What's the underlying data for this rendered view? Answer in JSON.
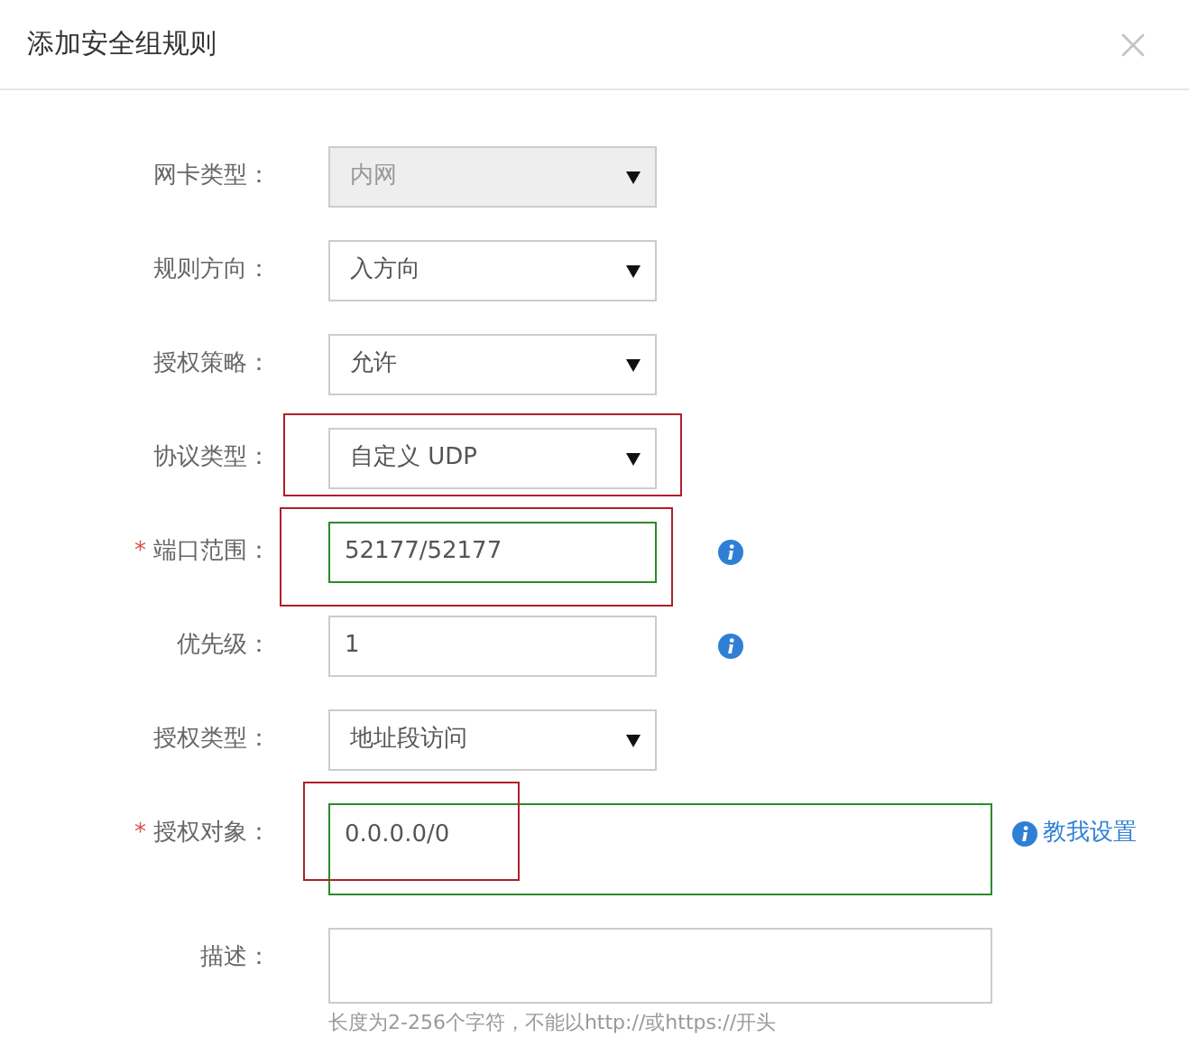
{
  "dialog": {
    "title": "添加安全组规则"
  },
  "fields": [
    {
      "label": "网卡类型：",
      "required": false,
      "kind": "select",
      "value": "内网",
      "disabled": true,
      "valid": false,
      "info": false,
      "annotated": false
    },
    {
      "label": "规则方向：",
      "required": false,
      "kind": "select",
      "value": "入方向",
      "disabled": false,
      "valid": false,
      "info": false,
      "annotated": false
    },
    {
      "label": "授权策略：",
      "required": false,
      "kind": "select",
      "value": "允许",
      "disabled": false,
      "valid": false,
      "info": false,
      "annotated": false
    },
    {
      "label": "协议类型：",
      "required": false,
      "kind": "select",
      "value": "自定义 UDP",
      "disabled": false,
      "valid": false,
      "info": false,
      "annotated": true
    },
    {
      "label": "端口范围：",
      "required": true,
      "required_mark": "*",
      "kind": "input",
      "value": "52177/52177",
      "disabled": false,
      "valid": true,
      "info": true,
      "annotated": true
    },
    {
      "label": "优先级：",
      "required": false,
      "kind": "input",
      "value": "1",
      "disabled": false,
      "valid": false,
      "info": true,
      "annotated": false
    },
    {
      "label": "授权类型：",
      "required": false,
      "kind": "select",
      "value": "地址段访问",
      "disabled": false,
      "valid": false,
      "info": false,
      "annotated": false
    },
    {
      "label": "授权对象：",
      "required": true,
      "required_mark": "*",
      "kind": "textarea",
      "value": "0.0.0.0/0",
      "disabled": false,
      "valid": true,
      "info": false,
      "help_link": "教我设置",
      "annotated": true
    },
    {
      "label": "描述：",
      "required": false,
      "kind": "textarea",
      "disabled": false,
      "valid": false,
      "info": false,
      "annotated": false,
      "hint": "长度为2-256个字符，不能以http://或https://开头"
    }
  ]
}
